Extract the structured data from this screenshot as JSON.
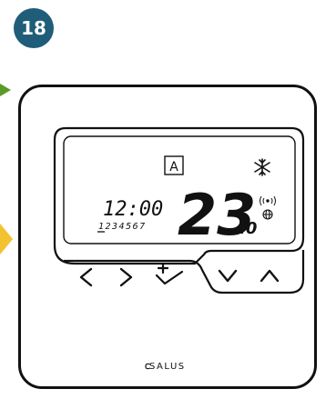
{
  "step_number": "18",
  "heading_partial": "…)( ... )",
  "device": {
    "mode_indicator": "A",
    "time": "12:00",
    "days": "1234567",
    "selected_day": "1",
    "temperature_main": "23",
    "temperature_decimal": ".0",
    "brand": "SALUS",
    "icons": [
      "snowflake-icon",
      "signal-icon",
      "globe-icon"
    ],
    "buttons": [
      "left-arrow",
      "right-arrow",
      "confirm-check",
      "down-arrow",
      "up-arrow"
    ]
  },
  "colors": {
    "badge": "#1f5d79",
    "arrow_green": "#5a9a2a",
    "arrow_yellow": "#f2c230",
    "outline": "#111111"
  }
}
